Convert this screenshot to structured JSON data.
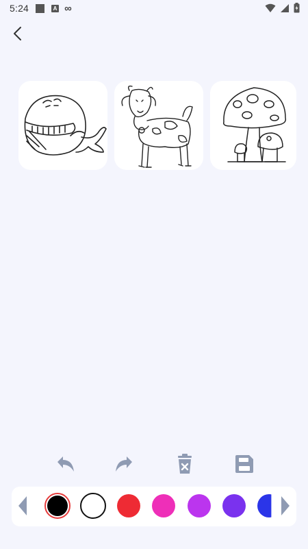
{
  "status_bar": {
    "time": "5:24",
    "a_badge": "A",
    "infinity": "∞"
  },
  "navigation": {
    "back_icon": "chevron-left-icon"
  },
  "drawings": [
    {
      "name": "whale",
      "icon": "whale-drawing"
    },
    {
      "name": "goat",
      "icon": "goat-drawing"
    },
    {
      "name": "mushroom",
      "icon": "mushroom-drawing"
    }
  ],
  "toolbar": {
    "undo_icon": "undo-icon",
    "redo_icon": "redo-icon",
    "clear_icon": "trash-icon",
    "save_icon": "save-icon",
    "icon_color": "#8f9bb3"
  },
  "palette": {
    "selected_index": 0,
    "colors": [
      "#000000",
      "#ffffff",
      "#ee2b34",
      "#ee2fb8",
      "#bb35ee",
      "#7a32ee",
      "#2b35e8"
    ],
    "arrow_color": "#8f9bb3"
  }
}
